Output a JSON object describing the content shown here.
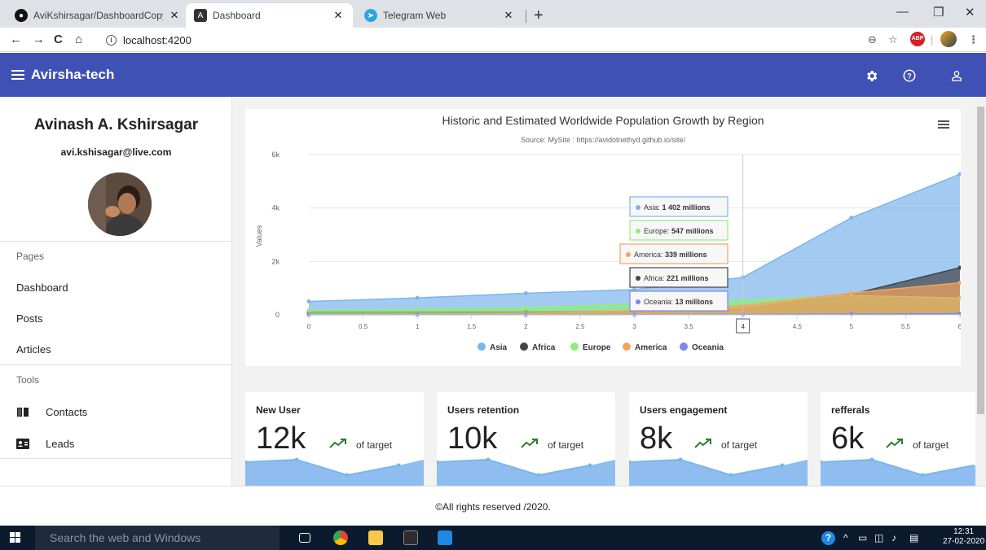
{
  "browser": {
    "tabs": [
      {
        "title": "AviKshirsagar/DashboardCopy1",
        "icon": "github-icon"
      },
      {
        "title": "Dashboard",
        "icon": "angular-icon"
      },
      {
        "title": "Telegram Web",
        "icon": "telegram-icon"
      }
    ],
    "url": "localhost:4200"
  },
  "app": {
    "title": "Avirsha-tech",
    "icons": [
      "settings-icon",
      "help-icon",
      "account-icon"
    ]
  },
  "sidebar": {
    "name": "Avinash A. Kshirsagar",
    "email": "avi.kshisagar@live.com",
    "pages_header": "Pages",
    "pages": [
      "Dashboard",
      "Posts",
      "Articles"
    ],
    "tools_header": "Tools",
    "tools": [
      {
        "label": "Contacts",
        "icon": "contacts-icon"
      },
      {
        "label": "Leads",
        "icon": "leads-icon"
      }
    ]
  },
  "chart_data": {
    "type": "area",
    "title": "Historic and Estimated Worldwide Population Growth by Region",
    "subtitle": "Source: MySite : https://avidotnethyd.github.io/site/",
    "ylabel": "Values",
    "xlabel": "",
    "x": [
      0,
      1,
      2,
      3,
      4,
      5,
      6
    ],
    "x_ticks": [
      "0",
      "0.5",
      "1",
      "1.5",
      "2",
      "2.5",
      "3",
      "3.5",
      "4",
      "4.5",
      "5",
      "5.5",
      "6"
    ],
    "y_ticks": [
      "0",
      "2k",
      "4k",
      "6k"
    ],
    "ylim": [
      0,
      6000
    ],
    "legend_position": "bottom",
    "series": [
      {
        "name": "Asia",
        "color": "#7cb5ec",
        "values": [
          502,
          635,
          809,
          947,
          1402,
          3634,
          5268
        ]
      },
      {
        "name": "Africa",
        "color": "#434348",
        "values": [
          106,
          107,
          111,
          133,
          221,
          767,
          1766
        ]
      },
      {
        "name": "Europe",
        "color": "#90ed7d",
        "values": [
          163,
          203,
          276,
          408,
          547,
          729,
          628
        ]
      },
      {
        "name": "America",
        "color": "#f7a35c",
        "values": [
          18,
          31,
          54,
          156,
          339,
          818,
          1201
        ]
      },
      {
        "name": "Oceania",
        "color": "#8085e9",
        "values": [
          2,
          2,
          2,
          6,
          13,
          30,
          46
        ]
      }
    ],
    "tooltip": {
      "x_label": "4",
      "rows": [
        {
          "series": "Asia",
          "value": "1 402 millions"
        },
        {
          "series": "Europe",
          "value": "547 millions"
        },
        {
          "series": "America",
          "value": "339 millions"
        },
        {
          "series": "Africa",
          "value": "221 millions"
        },
        {
          "series": "Oceania",
          "value": "13 millions"
        }
      ]
    }
  },
  "kpis": [
    {
      "title": "New User",
      "value": "12k",
      "target_label": "of target"
    },
    {
      "title": "Users retention",
      "value": "10k",
      "target_label": "of target"
    },
    {
      "title": "Users engagement",
      "value": "8k",
      "target_label": "of target"
    },
    {
      "title": "refferals",
      "value": "6k",
      "target_label": "of target"
    }
  ],
  "footer": "©All rights reserved /2020.",
  "taskbar": {
    "search_placeholder": "Search the web and Windows",
    "time": "12:31",
    "date": "27-02-2020"
  }
}
